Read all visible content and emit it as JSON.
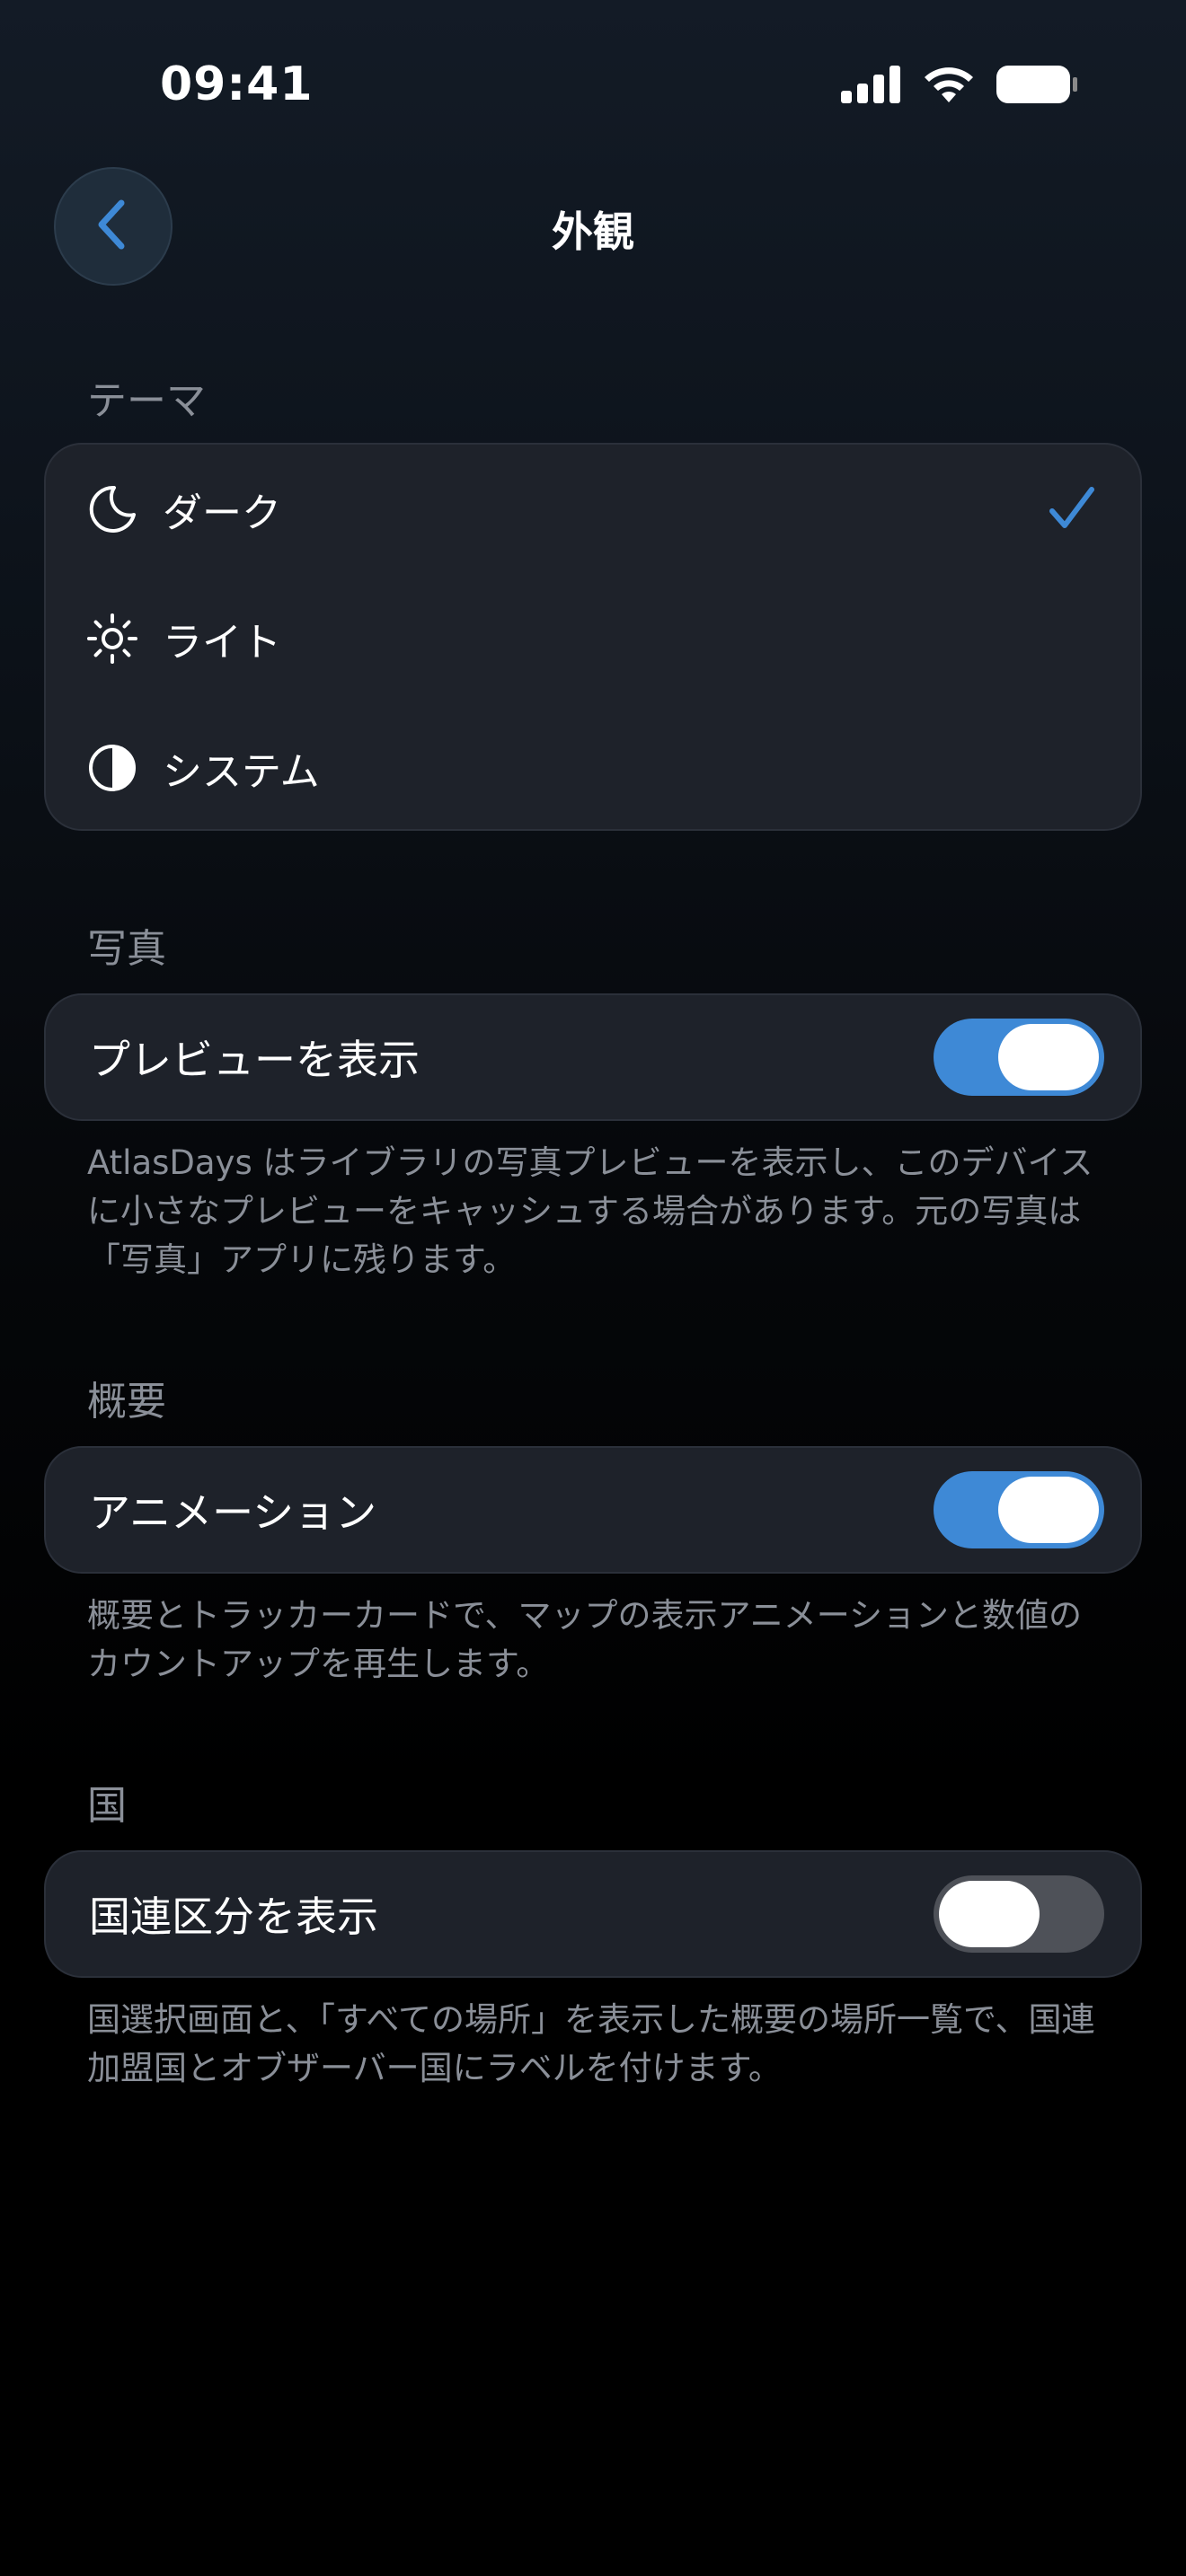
{
  "status_bar": {
    "time": "09:41",
    "icons": [
      "cellular-signal-icon",
      "wifi-icon",
      "battery-icon"
    ]
  },
  "nav": {
    "title": "外観",
    "back_icon": "chevron-left-icon"
  },
  "theme_section": {
    "header": "テーマ",
    "options": [
      {
        "label": "ダーク",
        "icon": "moon-icon",
        "selected": true
      },
      {
        "label": "ライト",
        "icon": "sun-icon",
        "selected": false
      },
      {
        "label": "システム",
        "icon": "half-circle-icon",
        "selected": false
      }
    ]
  },
  "photos_section": {
    "header": "写真",
    "toggle_label": "プレビューを表示",
    "toggle_on": true,
    "footnote": "AtlasDays はライブラリの写真プレビューを表示し、このデバイスに小さなプレビューをキャッシュする場合があります。元の写真は「写真」アプリに残ります。"
  },
  "overview_section": {
    "header": "概要",
    "toggle_label": "アニメーション",
    "toggle_on": true,
    "footnote": "概要とトラッカーカードで、マップの表示アニメーションと数値のカウントアップを再生します。"
  },
  "country_section": {
    "header": "国",
    "toggle_label": "国連区分を表示",
    "toggle_on": false,
    "footnote": "国選択画面と、「すべての場所」を表示した概要の場所一覧で、国連加盟国とオブザーバー国にラベルを付けます。"
  },
  "colors": {
    "accent": "#3e89d6",
    "card_bg": "#1e222a",
    "secondary_text": "#8a8f98"
  }
}
